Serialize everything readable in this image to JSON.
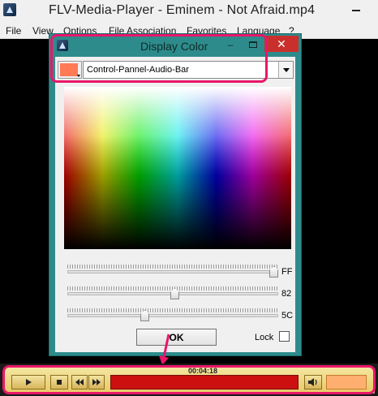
{
  "window": {
    "title": "FLV-Media-Player - Eminem - Not Afraid.mp4"
  },
  "menu": {
    "items": [
      "File",
      "View",
      "Options",
      "File Association",
      "Favorites",
      "Language",
      "?"
    ]
  },
  "dialog": {
    "title": "Display Color",
    "close_label": "✕",
    "min_label": "–",
    "selected_element": "Control-Pannel-Audio-Bar",
    "selected_color": "#ff7a55",
    "sliders": [
      {
        "label": "FF",
        "value": 255
      },
      {
        "label": "82",
        "value": 130
      },
      {
        "label": "5C",
        "value": 92
      }
    ],
    "ok_label": "OK",
    "lock_label": "Lock",
    "lock_checked": false
  },
  "player": {
    "time": "00:04:18",
    "progress_color": "#cc1010",
    "audio_bar_color": "#ffb070"
  },
  "annotation": {
    "highlight_color": "#e8176a"
  }
}
